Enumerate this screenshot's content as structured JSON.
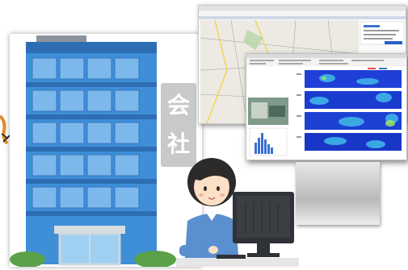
{
  "sign": {
    "char1": "会",
    "char2": "社"
  },
  "colors": {
    "building_blue": "#3e8ed8",
    "building_dark": "#2c6db4",
    "window_light": "#8ec5f0",
    "sign_gray": "#c7c9cb",
    "shirt_blue": "#5a8fd0",
    "hair_dark": "#2d2a2a",
    "monitor_dark": "#2f3236",
    "bush_green": "#5aa14a",
    "heatmap_blue": "#1a3fd1",
    "map_yellow": "#f0d64a"
  },
  "icons": {
    "building": "office-building-icon",
    "person": "office-worker-icon",
    "computer": "desktop-computer-icon"
  }
}
